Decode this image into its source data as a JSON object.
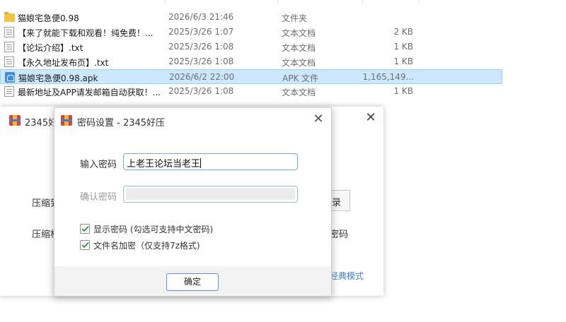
{
  "explorer": {
    "files": [
      {
        "name": "猫娘宅急便0.98",
        "date": "2026/6/3 21:46",
        "type": "文件夹",
        "size": "",
        "icon": "folder-icon"
      },
      {
        "name": "【来了就能下载和观看！纯免费！...",
        "date": "2025/3/26 1:07",
        "type": "文本文档",
        "size": "2 KB",
        "icon": "txt-file-icon"
      },
      {
        "name": "【论坛介绍】.txt",
        "date": "2025/3/26 1:08",
        "type": "文本文档",
        "size": "1 KB",
        "icon": "txt-file-icon"
      },
      {
        "name": "【永久地址发布页】.txt",
        "date": "2025/3/26 1:08",
        "type": "文本文档",
        "size": "1 KB",
        "icon": "txt-file-icon"
      },
      {
        "name": "猫娘宅急便0.98.apk",
        "date": "2026/6/2 22:00",
        "type": "APK 文件",
        "size": "1,165,149...",
        "icon": "apk-file-icon"
      },
      {
        "name": "最新地址及APP请发邮箱自动获取！...",
        "date": "2025/3/26 1:08",
        "type": "文本文档",
        "size": "1 KB",
        "icon": "txt-file-icon"
      }
    ],
    "selected_index": 4,
    "selection_color": "#cce8ff"
  },
  "bg_window": {
    "title": "2345好",
    "label_compress_to": "压缩到",
    "label_compress_format": "压缩格",
    "browse_fragment": "录",
    "right_label_fragment": "密码",
    "classic_mode_fragment": "经典模式"
  },
  "dialog": {
    "title": "密码设置 - 2345好压",
    "close_symbol": "✕",
    "password_label": "输入密码",
    "password_value": "上老王论坛当老王",
    "confirm_label": "确认密码",
    "confirm_value": "",
    "show_password": {
      "label": "显示密码 (勾选可支持中文密码)",
      "checked": true
    },
    "encrypt_filenames": {
      "label": "文件名加密（仅支持7z格式)",
      "checked": true
    },
    "ok_label": "确定"
  },
  "colors": {
    "accent_blue": "#3b82d6",
    "checkbox_green": "#2e9e3e",
    "focus_border": "#6fa8dc"
  }
}
